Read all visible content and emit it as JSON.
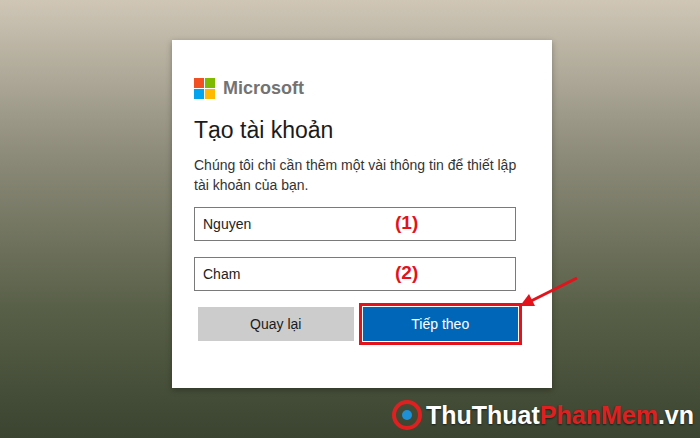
{
  "logo": {
    "text": "Microsoft"
  },
  "title": "Tạo tài khoản",
  "description": "Chúng tôi chỉ cần thêm một vài thông tin để thiết lập tài khoản của bạn.",
  "fields": [
    {
      "value": "Nguyen",
      "annotation": "(1)"
    },
    {
      "value": "Cham",
      "annotation": "(2)"
    }
  ],
  "buttons": [
    {
      "label": "Quay lại",
      "kind": "secondary",
      "highlighted": false
    },
    {
      "label": "Tiếp theo",
      "kind": "primary",
      "highlighted": true
    }
  ],
  "watermark": {
    "parts": [
      {
        "text": "ThuThuat",
        "color": "#ffffff"
      },
      {
        "text": "PhanMem",
        "color": "#e02020"
      },
      {
        "text": ".vn",
        "color": "#ffffff"
      }
    ]
  }
}
